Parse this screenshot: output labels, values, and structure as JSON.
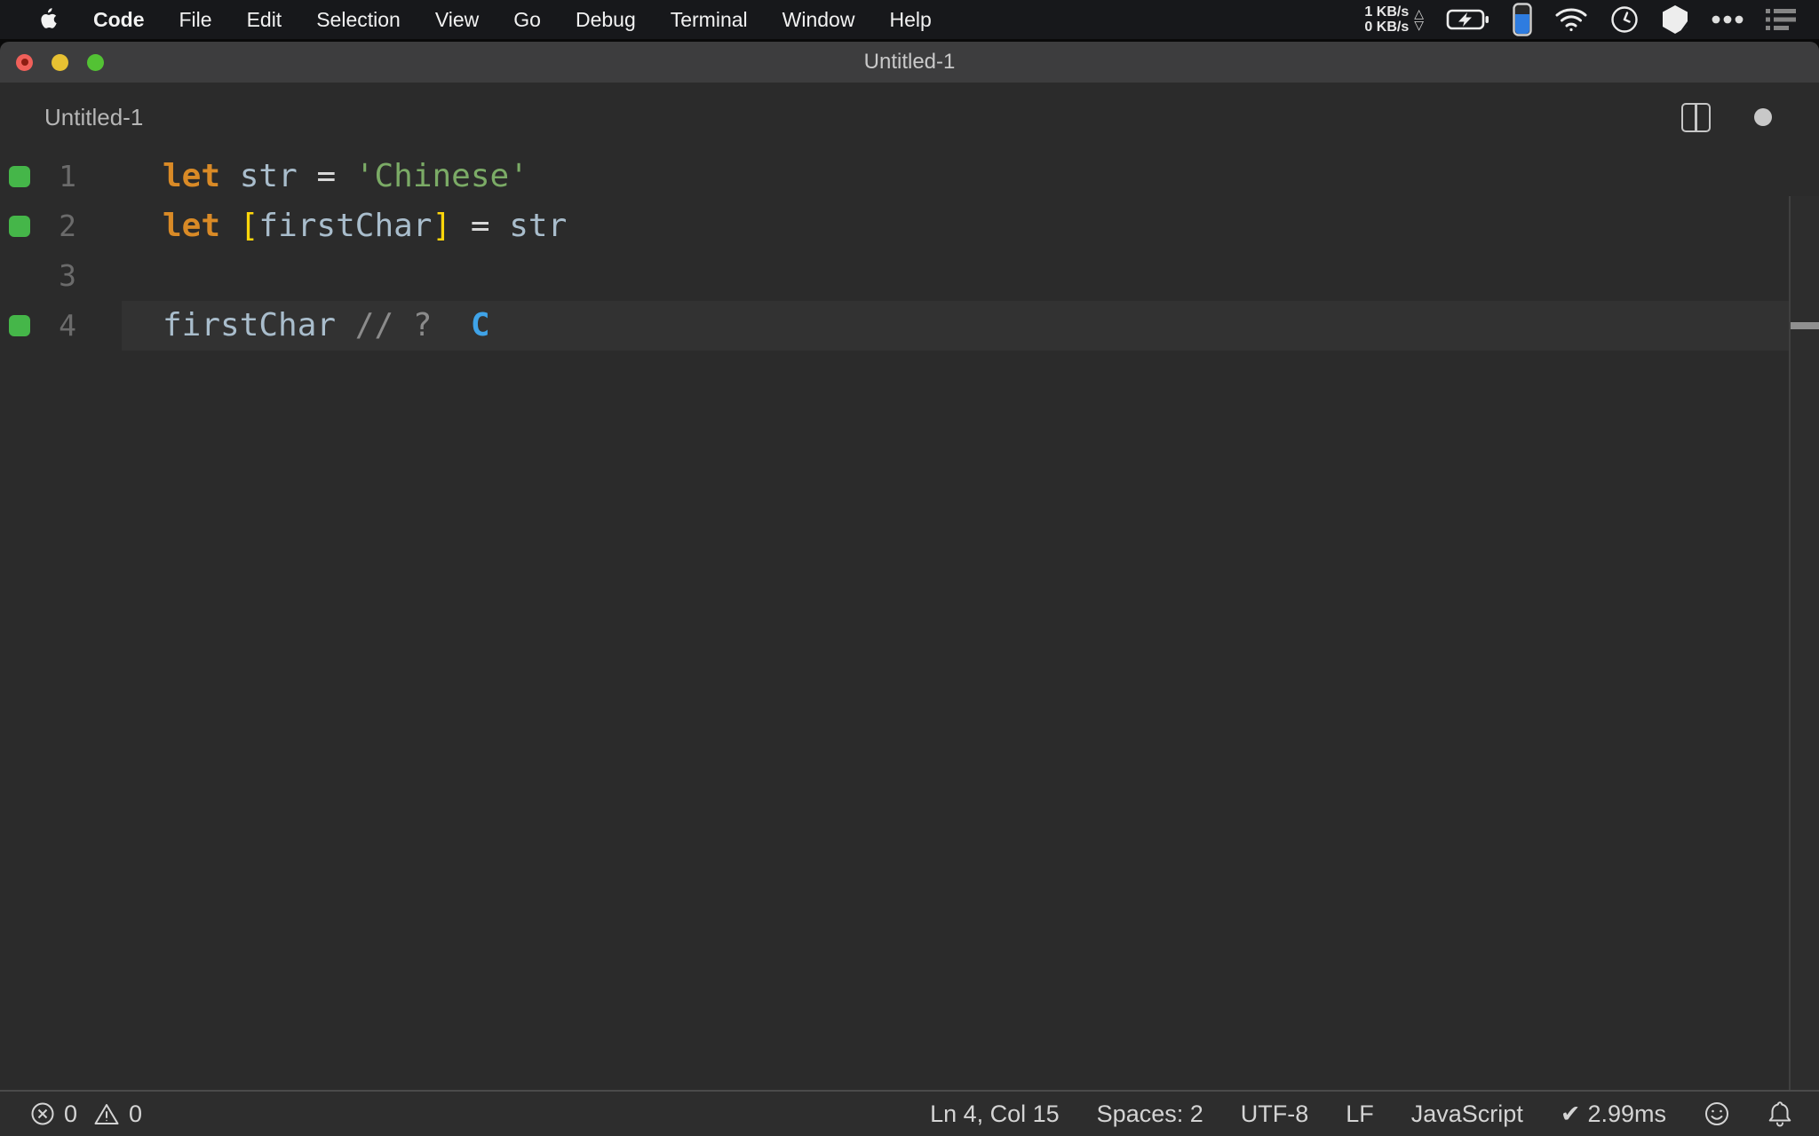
{
  "colors": {
    "bg": "#2b2b2b",
    "menubar-bg": "#17181b",
    "titlebar-bg": "#3d3d3e",
    "statusbar-bg": "#2d2d2d",
    "current-line": "#323232",
    "keyword": "#d98a26",
    "variable": "#a9bdcc",
    "operator": "#d8d8d8",
    "string": "#7bab66",
    "bracket": "#ffd60a",
    "comment": "#8b8b8b",
    "annotation": "#3fa3e8",
    "line-number": "#6b6b6b",
    "gutter-marker": "#45b649",
    "accent-blue": "#2e7ce0",
    "traffic-red": "#f0605a",
    "traffic-yellow": "#e7c132",
    "traffic-green": "#53c234"
  },
  "menu_bar": {
    "apple_icon": "apple-logo-icon",
    "items": [
      "Code",
      "File",
      "Edit",
      "Selection",
      "View",
      "Go",
      "Debug",
      "Terminal",
      "Window",
      "Help"
    ],
    "network": {
      "up": "1 KB/s",
      "down": "0 KB/s",
      "up_arrow": "△",
      "down_arrow": "▽"
    },
    "status_icons": [
      "battery-charging-icon",
      "vertical-battery-icon",
      "wifi-icon",
      "clock-icon",
      "cube-icon",
      "more-dots-icon",
      "list-icon"
    ]
  },
  "window": {
    "title": "Untitled-1",
    "tab_label": "Untitled-1",
    "header_icons": [
      "split-editor-icon",
      "unsaved-dot-icon"
    ]
  },
  "editor": {
    "lines": [
      {
        "number": "1",
        "marker": true,
        "current": false,
        "tokens": [
          {
            "t": "let",
            "s": "kw"
          },
          {
            "t": " ",
            "s": "pl"
          },
          {
            "t": "str",
            "s": "var"
          },
          {
            "t": " ",
            "s": "pl"
          },
          {
            "t": "=",
            "s": "op"
          },
          {
            "t": " ",
            "s": "pl"
          },
          {
            "t": "'Chinese'",
            "s": "str"
          }
        ]
      },
      {
        "number": "2",
        "marker": true,
        "current": false,
        "tokens": [
          {
            "t": "let",
            "s": "kw"
          },
          {
            "t": " ",
            "s": "pl"
          },
          {
            "t": "[",
            "s": "br"
          },
          {
            "t": "firstChar",
            "s": "var"
          },
          {
            "t": "]",
            "s": "br"
          },
          {
            "t": " ",
            "s": "pl"
          },
          {
            "t": "=",
            "s": "op"
          },
          {
            "t": " ",
            "s": "pl"
          },
          {
            "t": "str",
            "s": "var"
          }
        ]
      },
      {
        "number": "3",
        "marker": false,
        "current": false,
        "tokens": []
      },
      {
        "number": "4",
        "marker": true,
        "current": true,
        "tokens": [
          {
            "t": "firstChar",
            "s": "var"
          },
          {
            "t": " ",
            "s": "pl"
          },
          {
            "t": "// ?",
            "s": "cm"
          },
          {
            "t": "  ",
            "s": "pl"
          },
          {
            "t": "C",
            "s": "an"
          }
        ]
      }
    ]
  },
  "status_bar": {
    "errors": "0",
    "warnings": "0",
    "cursor": "Ln 4, Col 15",
    "indent": "Spaces: 2",
    "encoding": "UTF-8",
    "eol": "LF",
    "language": "JavaScript",
    "perf_check": "✔",
    "perf": "2.99ms",
    "icons": [
      "errors-icon",
      "warnings-icon",
      "feedback-smiley-icon",
      "notifications-bell-icon"
    ]
  }
}
